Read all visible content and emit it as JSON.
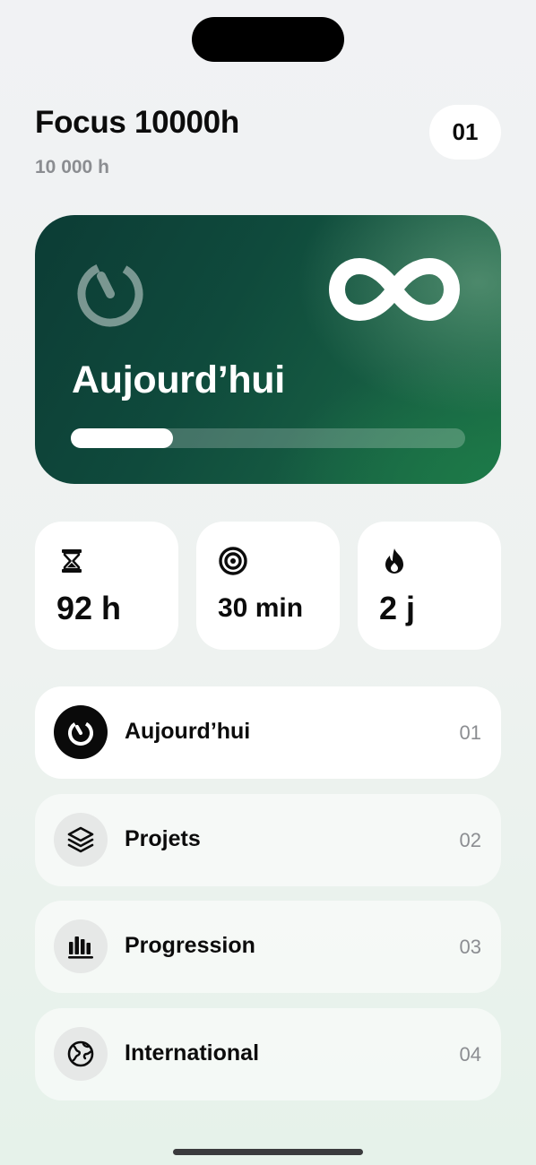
{
  "header": {
    "title": "Focus 10000h",
    "subtitle": "10 000 h",
    "badge": "01"
  },
  "hero": {
    "label": "Aujourd’hui",
    "progress": 0.26,
    "icons": [
      "timer-icon",
      "infinity-icon"
    ]
  },
  "stats": [
    {
      "icon": "hourglass-icon",
      "value": "92 h"
    },
    {
      "icon": "target-icon",
      "value": "30 min"
    },
    {
      "icon": "flame-icon",
      "value": "2 j"
    }
  ],
  "menu": [
    {
      "icon": "timer-icon",
      "label": "Aujourd’hui",
      "number": "01",
      "active": true
    },
    {
      "icon": "layers-icon",
      "label": "Projets",
      "number": "02",
      "active": false
    },
    {
      "icon": "bar-chart-icon",
      "label": "Progression",
      "number": "03",
      "active": false
    },
    {
      "icon": "globe-icon",
      "label": "International",
      "number": "04",
      "active": false
    }
  ],
  "colors": {
    "hero_dark": "#0c3c35",
    "hero_light": "#1d7a48",
    "accent_text": "#0c0c0c",
    "muted_text": "#8b8d91"
  }
}
